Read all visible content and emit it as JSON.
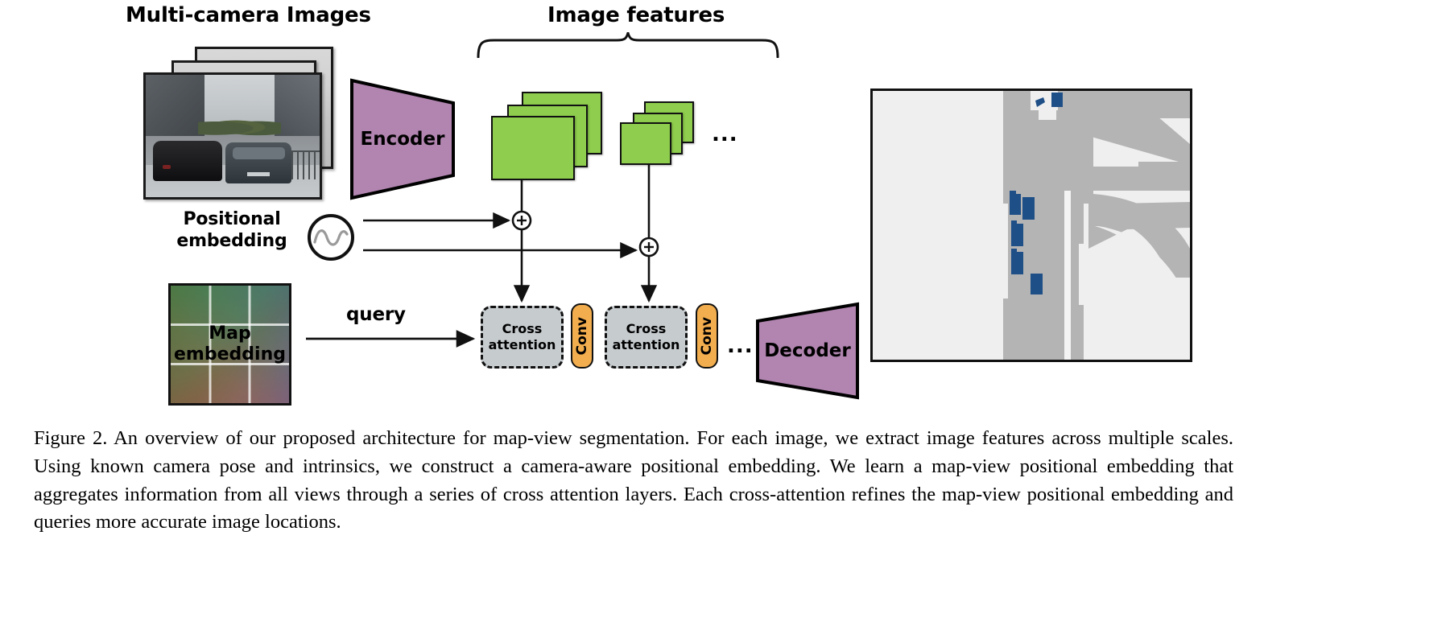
{
  "figure": {
    "titles": {
      "multi_camera": "Multi-camera Images",
      "image_features": "Image features"
    },
    "encoder": {
      "label": "Encoder",
      "color": "#b185b0"
    },
    "decoder": {
      "label": "Decoder",
      "color": "#b185b0"
    },
    "positional_embedding": {
      "label_line1": "Positional",
      "label_line2": "embedding"
    },
    "map_embedding": {
      "label_line1": "Map",
      "label_line2": "embedding"
    },
    "query": {
      "label": "query"
    },
    "blocks": [
      {
        "type": "cross-attention",
        "line1": "Cross",
        "line2": "attention"
      },
      {
        "type": "conv",
        "label": "Conv"
      },
      {
        "type": "cross-attention",
        "line1": "Cross",
        "line2": "attention"
      },
      {
        "type": "conv",
        "label": "Conv"
      }
    ],
    "ellipsis_features": "...",
    "ellipsis_blocks": "...",
    "operators": {
      "add": "+"
    },
    "colors": {
      "feature_map": "#8ecd4d",
      "conv": "#f2ad4e",
      "cross_attention": "#c6cbce",
      "encoder_decoder": "#b185b0",
      "bev_drivable": "#b4b4b4",
      "bev_background": "#efefef",
      "bev_vehicle": "#1f4f87",
      "stroke": "#111111"
    }
  },
  "caption": {
    "number": "Figure 2.",
    "text": " An overview of our proposed architecture for map-view segmentation. For each image, we extract image features across multiple scales.  Using known camera pose and intrinsics, we construct a camera-aware positional embedding. We learn a map-view positional embedding that aggregates information from all views through a series of cross attention layers. Each cross-attention refines the map-view positional embedding and queries more accurate image locations."
  }
}
